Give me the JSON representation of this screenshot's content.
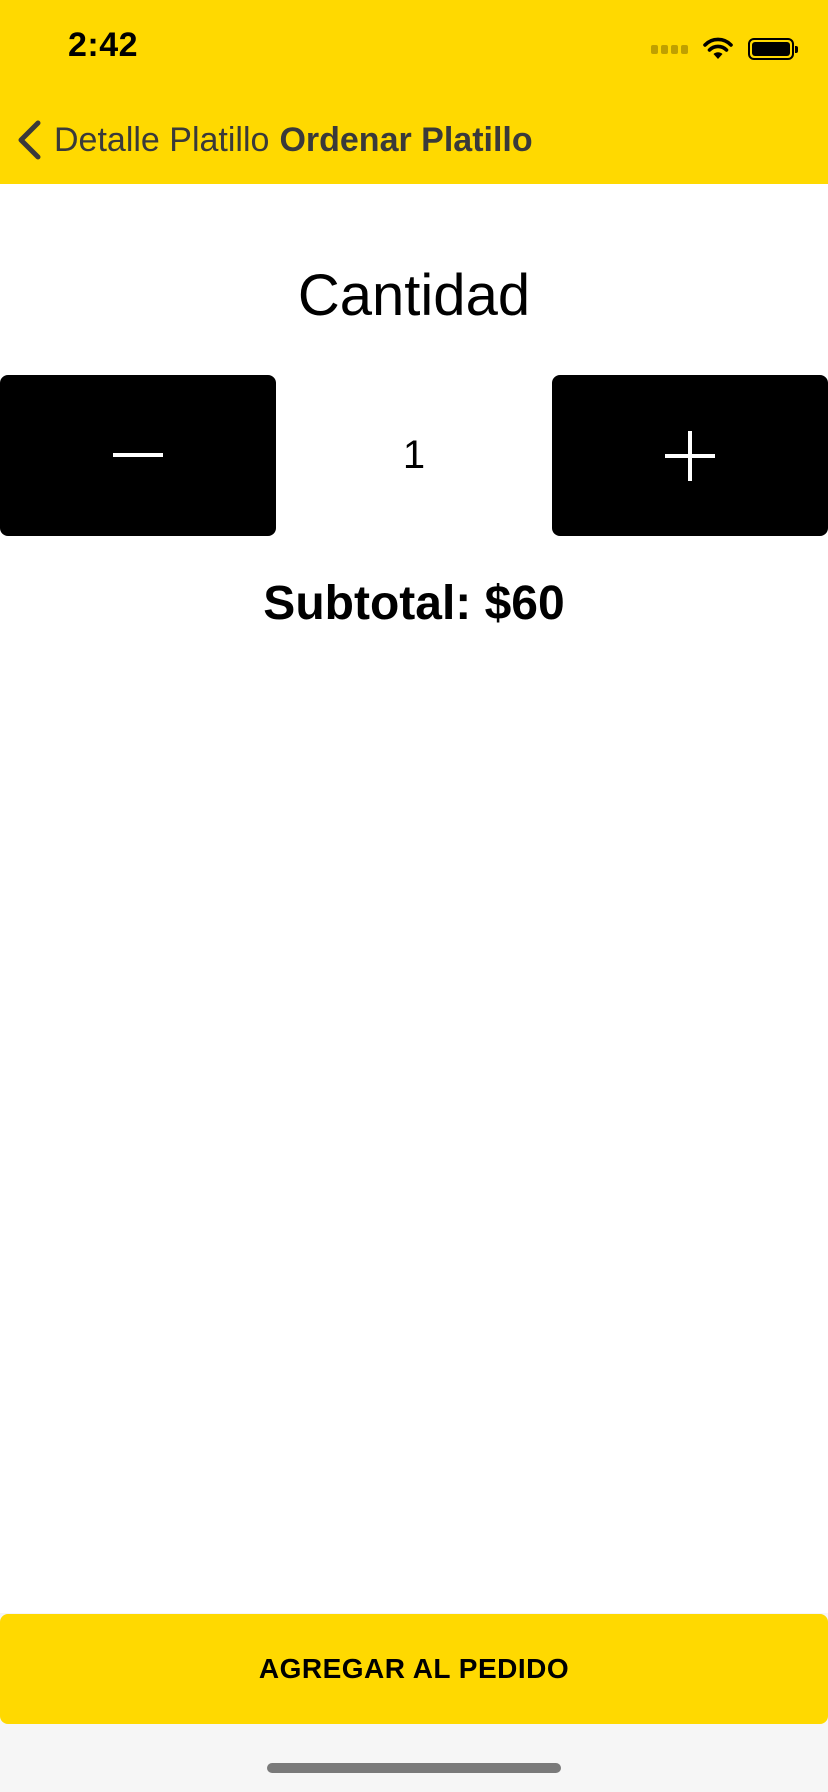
{
  "status_bar": {
    "time": "2:42"
  },
  "nav": {
    "back_label": "Detalle Platillo",
    "title": "Ordenar Platillo"
  },
  "content": {
    "quantity_label": "Cantidad",
    "quantity_value": "1",
    "subtotal": "Subtotal: $60"
  },
  "footer": {
    "add_button_label": "AGREGAR AL PEDIDO"
  },
  "icons": {
    "back": "chevron-left-icon",
    "minus": "minus-icon",
    "plus": "plus-icon",
    "wifi": "wifi-icon",
    "battery": "battery-icon",
    "signal": "signal-icon"
  },
  "colors": {
    "accent": "#FFD900",
    "button_dark": "#000000",
    "nav_text": "#3A3A3A"
  }
}
